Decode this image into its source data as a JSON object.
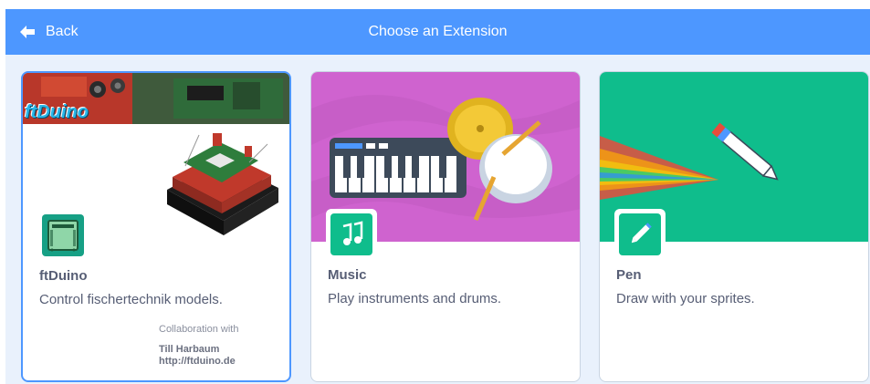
{
  "header": {
    "back_label": "Back",
    "title": "Choose an Extension",
    "color": "#4d97ff"
  },
  "extensions": [
    {
      "name": "ftDuino",
      "description": "Control fischertechnik models.",
      "banner_text": "ftDuino",
      "collaboration_label": "Collaboration with",
      "collaborator": "Till Harbaum",
      "collaborator_url": "http://ftduino.de",
      "icon": "ftduino-board-icon",
      "selected": true
    },
    {
      "name": "Music",
      "description": "Play instruments and drums.",
      "icon": "music-notes-icon",
      "accent": "#cf63cf"
    },
    {
      "name": "Pen",
      "description": "Draw with your sprites.",
      "icon": "pen-icon",
      "accent": "#0fbd8c"
    }
  ]
}
